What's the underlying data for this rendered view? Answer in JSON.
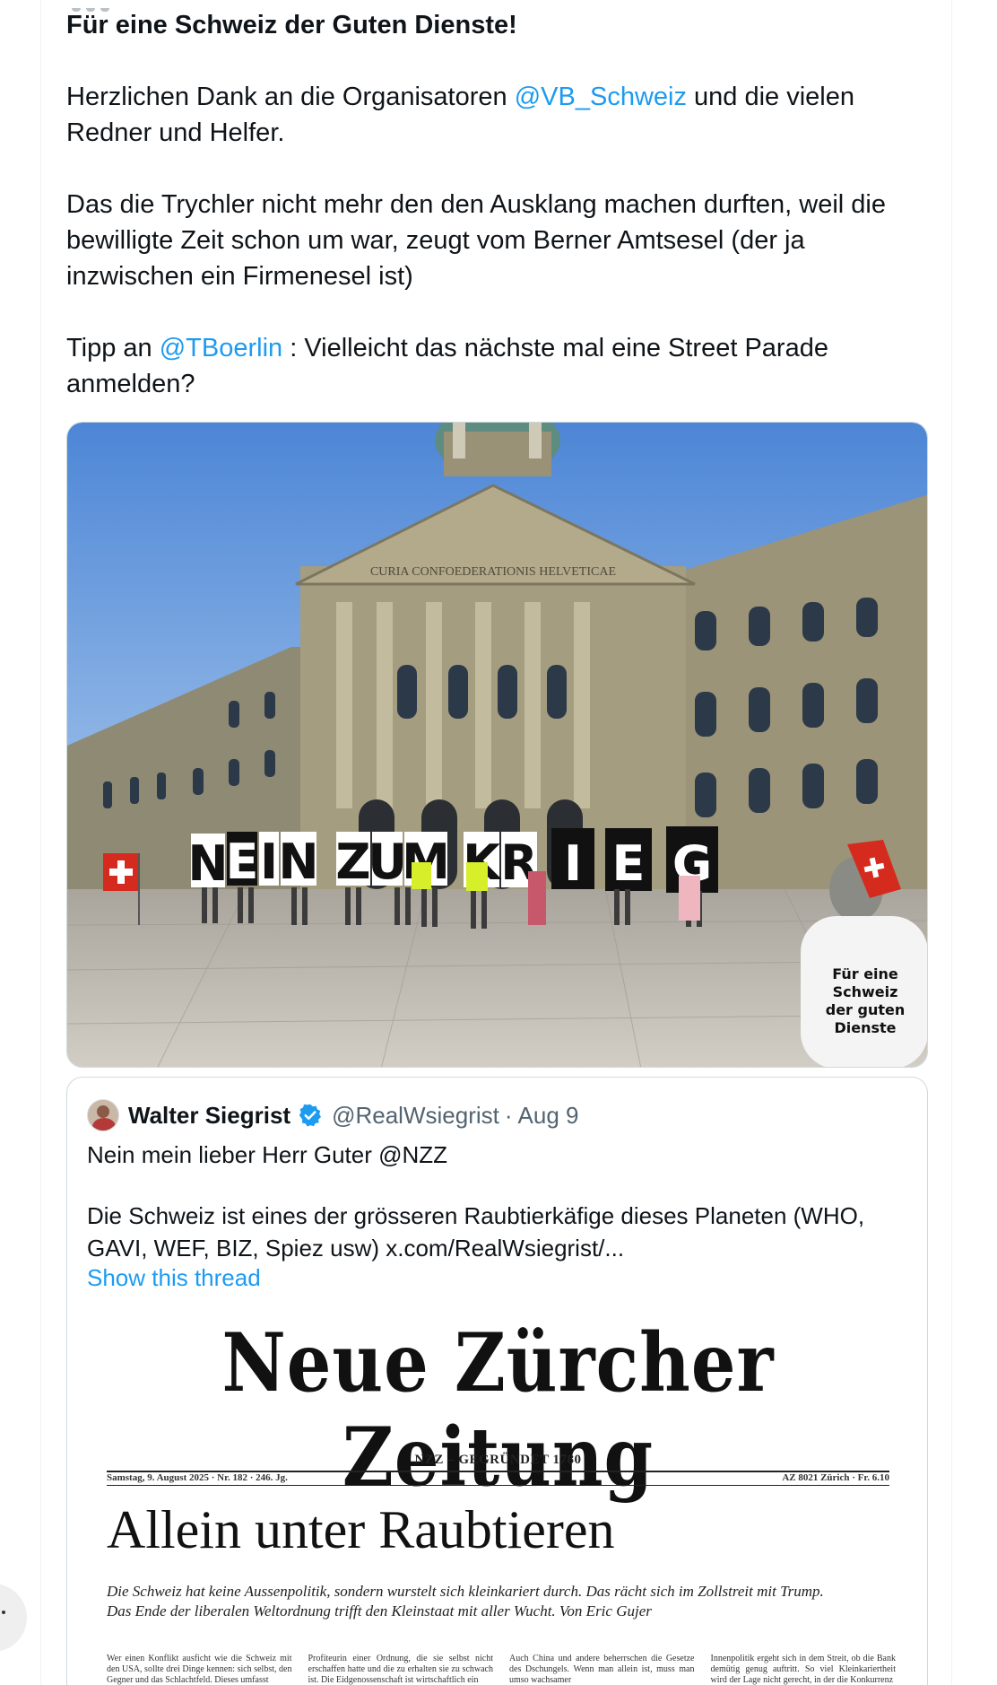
{
  "post": {
    "title": "Für eine Schweiz der Guten Dienste!",
    "p1_before": "Herzlichen Dank an die Organisatoren ",
    "p1_mention": "@VB_Schweiz",
    "p1_after": " und  die vielen",
    "p1_line2": "Redner und Helfer.",
    "p2_line1": "Das die Trychler nicht mehr den den Ausklang machen durften, weil die",
    "p2_line2": "bewilligte Zeit schon um war, zeugt vom Berner Amtsesel (der ja",
    "p2_line3": "inzwischen ein Firmenesel ist)",
    "p3_before": "Tipp an ",
    "p3_mention": "@TBoerlin",
    "p3_after": " : Vielleicht das nächste mal eine Street Parade",
    "p3_line2": "anmelden?"
  },
  "photo": {
    "letters": [
      "N",
      "E",
      "I",
      "N",
      "Z",
      "U",
      "M",
      "K",
      "R",
      "I",
      "E",
      "G"
    ],
    "inscription": "CURIA CONFOEDERATIONIS HELVETICAE",
    "shirt": [
      "Für eine",
      "Schweiz",
      "der guten",
      "Dienste"
    ]
  },
  "quote": {
    "name": "Walter Siegrist",
    "handle": "@RealWsiegrist",
    "separator": "·",
    "date": "Aug 9",
    "line1": "Nein mein lieber Herr Guter @NZZ",
    "line2": "Die Schweiz ist eines der grösseren Raubtierkäfige dieses Planeten (WHO,",
    "line3": "GAVI, WEF, BIZ, Spiez usw)  x.com/RealWsiegrist/...",
    "show_thread": "Show this thread"
  },
  "nzz": {
    "masthead": "Neue Zürcher Zeitung",
    "sub": "NZZ – GEGRÜNDET 1780",
    "date": "Samstag, 9. August 2025  ·  Nr. 182  ·  246. Jg.",
    "price": "AZ 8021 Zürich  ·  Fr. 6.10",
    "headline": "Allein unter Raubtieren",
    "deck1": "Die Schweiz hat keine Aussenpolitik, sondern wurstelt sich kleinkariert durch. Das rächt sich im Zollstreit mit Trump.",
    "deck2": "Das Ende der liberalen Weltordnung trifft den Kleinstaat mit aller Wucht. Von Eric Gujer",
    "col1": "Wer einen Konflikt ausficht wie die Schweiz mit den USA, sollte drei Dinge kennen: sich selbst, den Gegner und das Schlachtfeld. Dieses umfasst",
    "col2": "Profiteurin einer Ordnung, die sie selbst nicht erschaffen hatte und die zu erhalten sie zu schwach ist. Die Eidgenossenschaft ist wirtschaftlich ein",
    "col3": "Auch China und andere beherrschen die Gesetze des Dschungels. Wenn man allein ist, muss man umso wachsamer",
    "col4": "Innenpolitik ergeht sich in dem Streit, ob die Bank demütig genug auftritt. So viel Kleinkariertheit wird der Lage nicht gerecht, in der die Konkurrenz"
  },
  "colors": {
    "accent": "#1d9bf0",
    "text": "#0f1419",
    "muted": "#536471",
    "border": "#cfd9de"
  }
}
